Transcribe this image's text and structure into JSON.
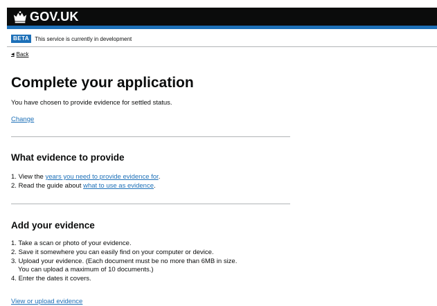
{
  "header": {
    "logo_text": "GOV.UK"
  },
  "phase": {
    "tag": "BETA",
    "text": "This service is currently in development"
  },
  "back_link": "Back",
  "title": "Complete your application",
  "intro": "You have chosen to provide evidence for settled status.",
  "change_link": "Change",
  "section1": {
    "heading": "What evidence to provide",
    "items": [
      {
        "num": "1.",
        "before": "View the ",
        "link": "years you need to provide evidence for",
        "after": "."
      },
      {
        "num": "2.",
        "before": "Read the guide about ",
        "link": "what to use as evidence",
        "after": "."
      }
    ]
  },
  "section2": {
    "heading": "Add your evidence",
    "items": [
      {
        "num": "1.",
        "text": "Take a scan or photo of your evidence."
      },
      {
        "num": "2.",
        "text": "Save it somewhere you can easily find on your computer or device."
      },
      {
        "num": "3.",
        "text": "Upload your evidence. (Each document must be no more than 6MB in size.",
        "text2": "You can upload a maximum of 10 documents.)"
      },
      {
        "num": "4.",
        "text": "Enter the dates it covers."
      }
    ],
    "link": "View or upload evidence"
  }
}
